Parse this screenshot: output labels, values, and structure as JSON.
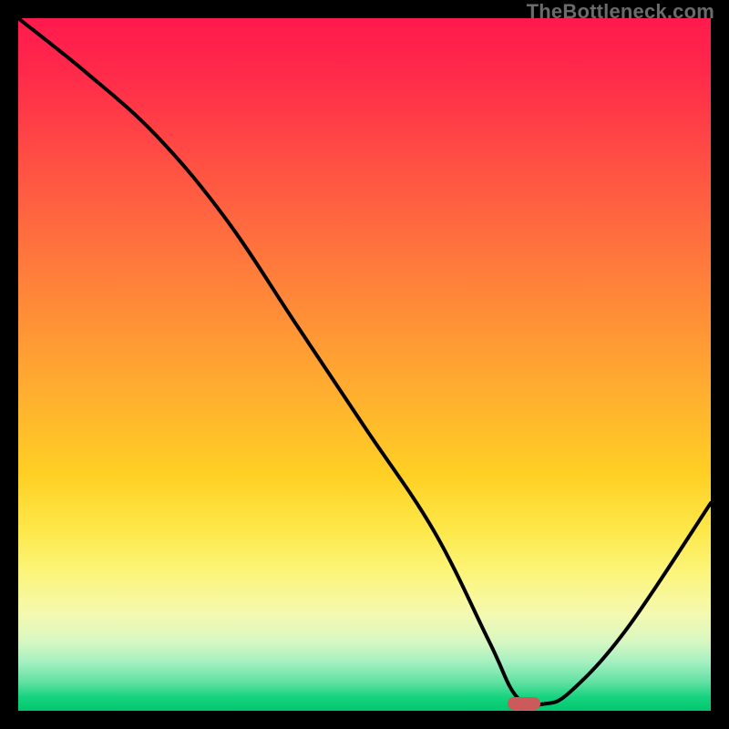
{
  "watermark": "TheBottleneck.com",
  "chart_data": {
    "type": "line",
    "title": "",
    "xlabel": "",
    "ylabel": "",
    "xlim": [
      0,
      100
    ],
    "ylim": [
      0,
      100
    ],
    "series": [
      {
        "name": "bottleneck-curve",
        "x": [
          0,
          10,
          20,
          30,
          40,
          50,
          60,
          68,
          72,
          76,
          80,
          88,
          100
        ],
        "y": [
          100,
          92,
          83,
          71,
          56,
          41,
          26,
          10,
          2,
          1,
          3,
          12,
          30
        ]
      }
    ],
    "marker": {
      "x": 73,
      "y": 1
    },
    "gradient_stops": [
      {
        "pct": 0,
        "color": "#ff1a4d"
      },
      {
        "pct": 50,
        "color": "#ffae2f"
      },
      {
        "pct": 80,
        "color": "#fcf57a"
      },
      {
        "pct": 100,
        "color": "#00c86e"
      }
    ]
  }
}
